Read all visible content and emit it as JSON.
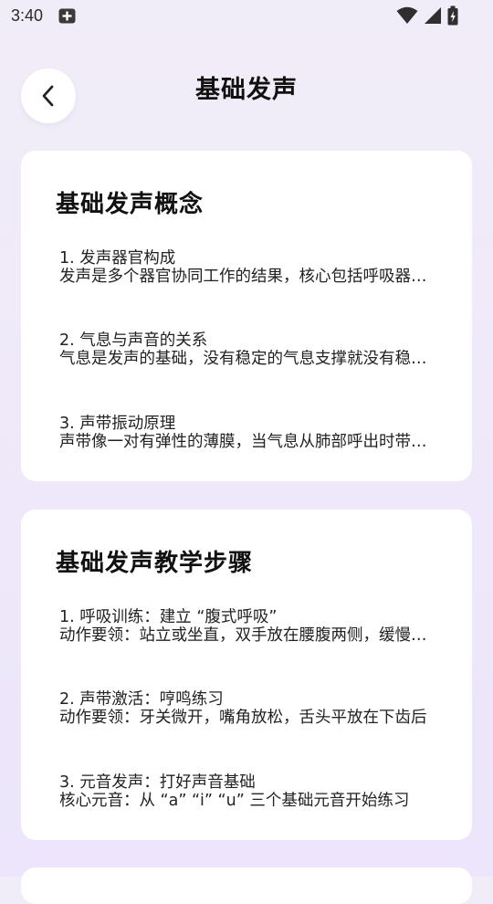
{
  "status_bar": {
    "time": "3:40"
  },
  "header": {
    "title": "基础发声"
  },
  "sections": [
    {
      "title": "基础发声概念",
      "items": [
        {
          "title": "1. 发声器官构成",
          "desc": "发声是多个器官协同工作的结果，核心包括呼吸器官、发声器官和共鸣器官"
        },
        {
          "title": "2. 气息与声音的关系",
          "desc": "气息是发声的基础，没有稳定的气息支撑就没有稳定的声音"
        },
        {
          "title": "3. 声带振动原理",
          "desc": "声带像一对有弹性的薄膜，当气息从肺部呼出时带动声带振动"
        }
      ]
    },
    {
      "title": "基础发声教学步骤",
      "items": [
        {
          "title": "1. 呼吸训练：建立 “腹式呼吸”",
          "desc": "动作要领：站立或坐直，双手放在腰腹两侧，缓慢吸气"
        },
        {
          "title": "2. 声带激活：哼鸣练习",
          "desc": "动作要领：牙关微开，嘴角放松，舌头平放在下齿后"
        },
        {
          "title": "3. 元音发声：打好声音基础",
          "desc": "核心元音：从 “a” “i” “u” 三个基础元音开始练习"
        }
      ]
    }
  ],
  "colors": {
    "background_top": "#f1edf8",
    "background_bottom": "#ece5fb",
    "card": "#ffffff",
    "text": "#111111"
  }
}
